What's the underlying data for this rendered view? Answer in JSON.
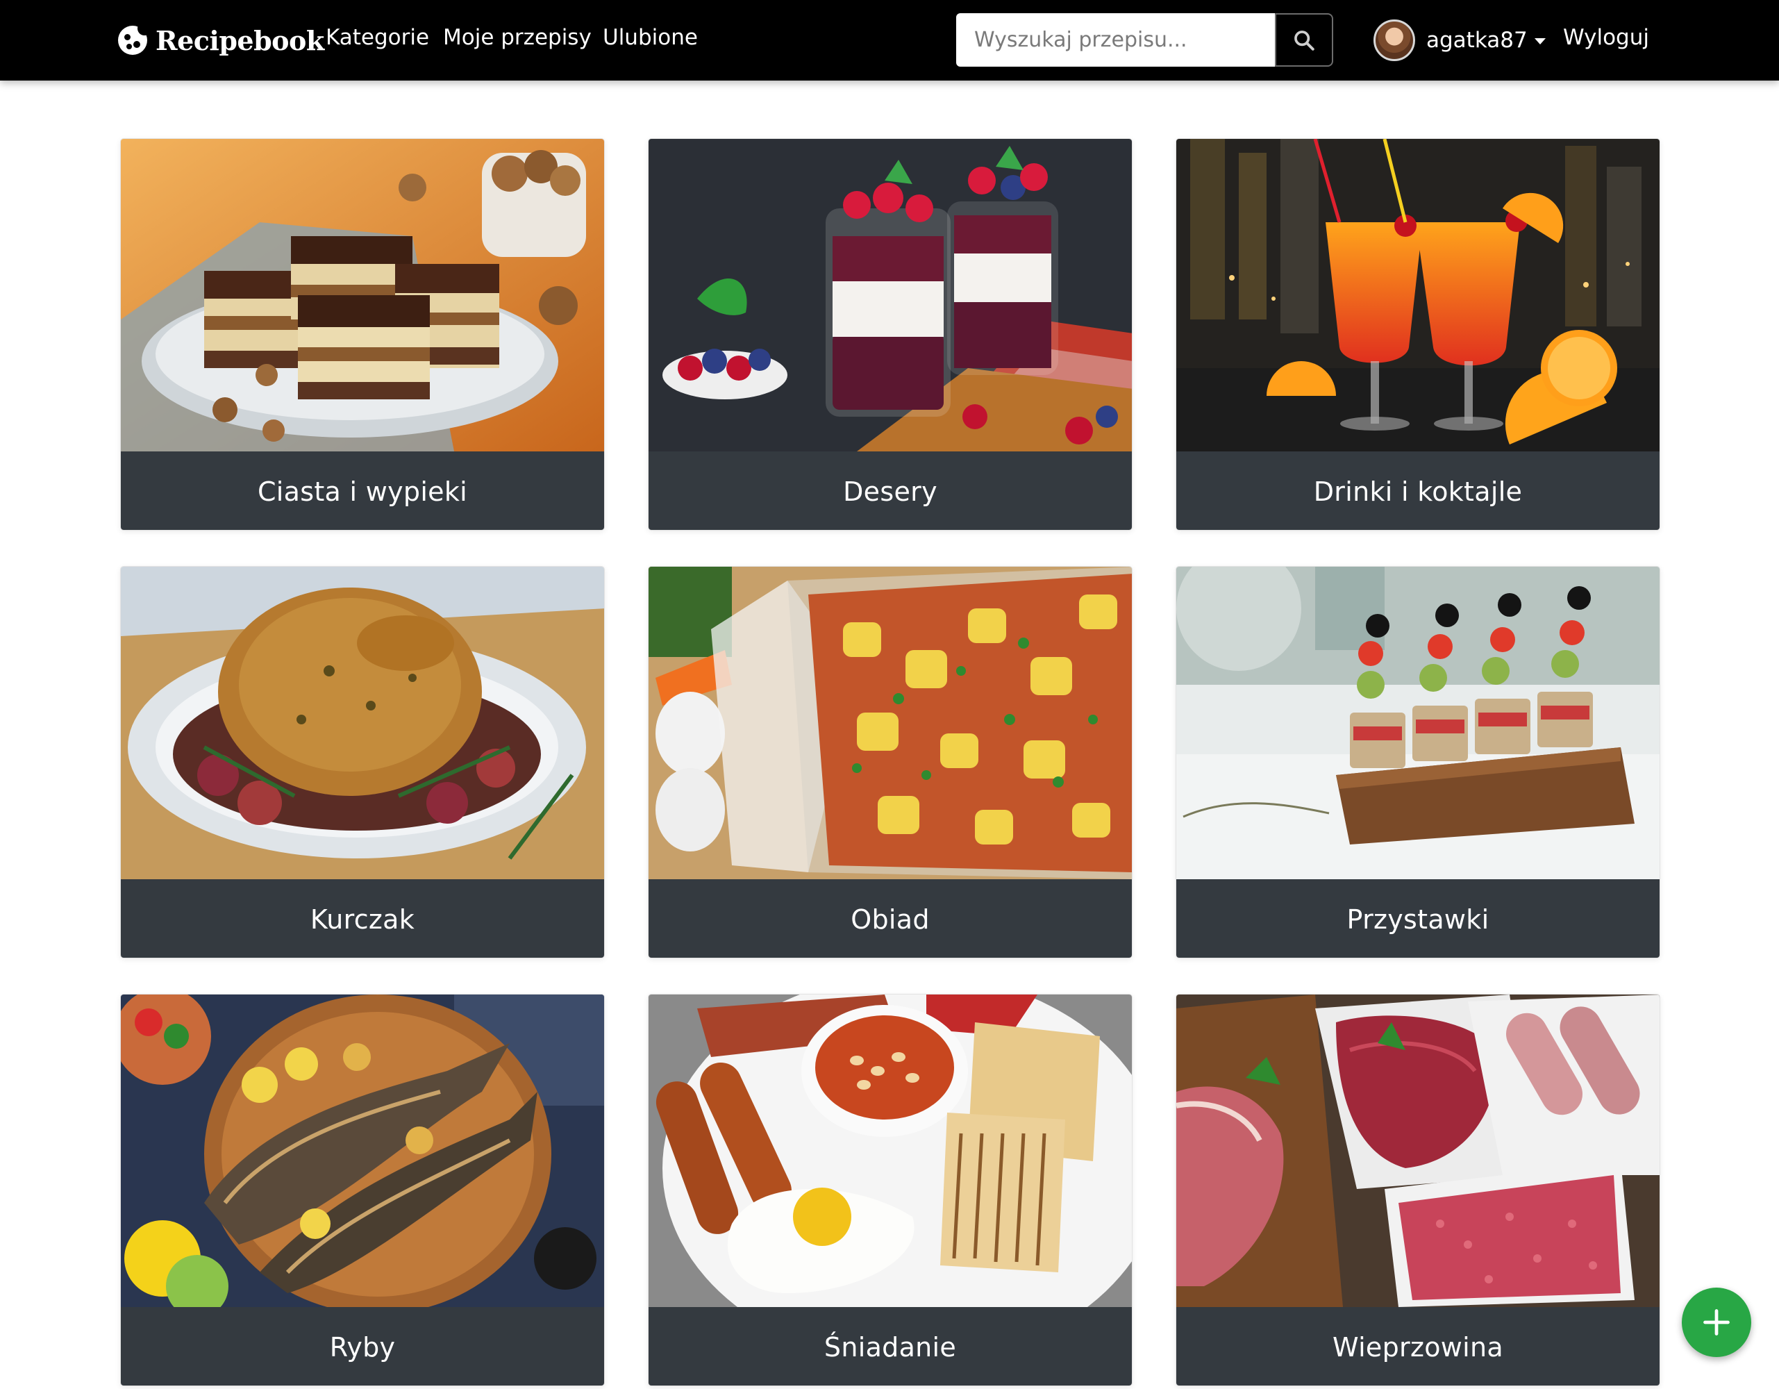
{
  "app": {
    "brand": "Recipebook"
  },
  "nav": {
    "links": [
      "Kategorie",
      "Moje przepisy",
      "Ulubione"
    ],
    "search_placeholder": "Wyszukaj przepisu...",
    "username": "agatka87",
    "logout": "Wyloguj"
  },
  "categories": [
    {
      "label": "Ciasta i wypieki"
    },
    {
      "label": "Desery"
    },
    {
      "label": "Drinki i koktajle"
    },
    {
      "label": "Kurczak"
    },
    {
      "label": "Obiad"
    },
    {
      "label": "Przystawki"
    },
    {
      "label": "Ryby"
    },
    {
      "label": "Śniadanie"
    },
    {
      "label": "Wieprzowina"
    }
  ],
  "colors": {
    "navbar": "#000000",
    "card_footer": "#343a40",
    "fab": "#28a745"
  },
  "icons": {
    "brand": "cookie-icon",
    "search": "search-icon",
    "add": "plus-icon"
  }
}
